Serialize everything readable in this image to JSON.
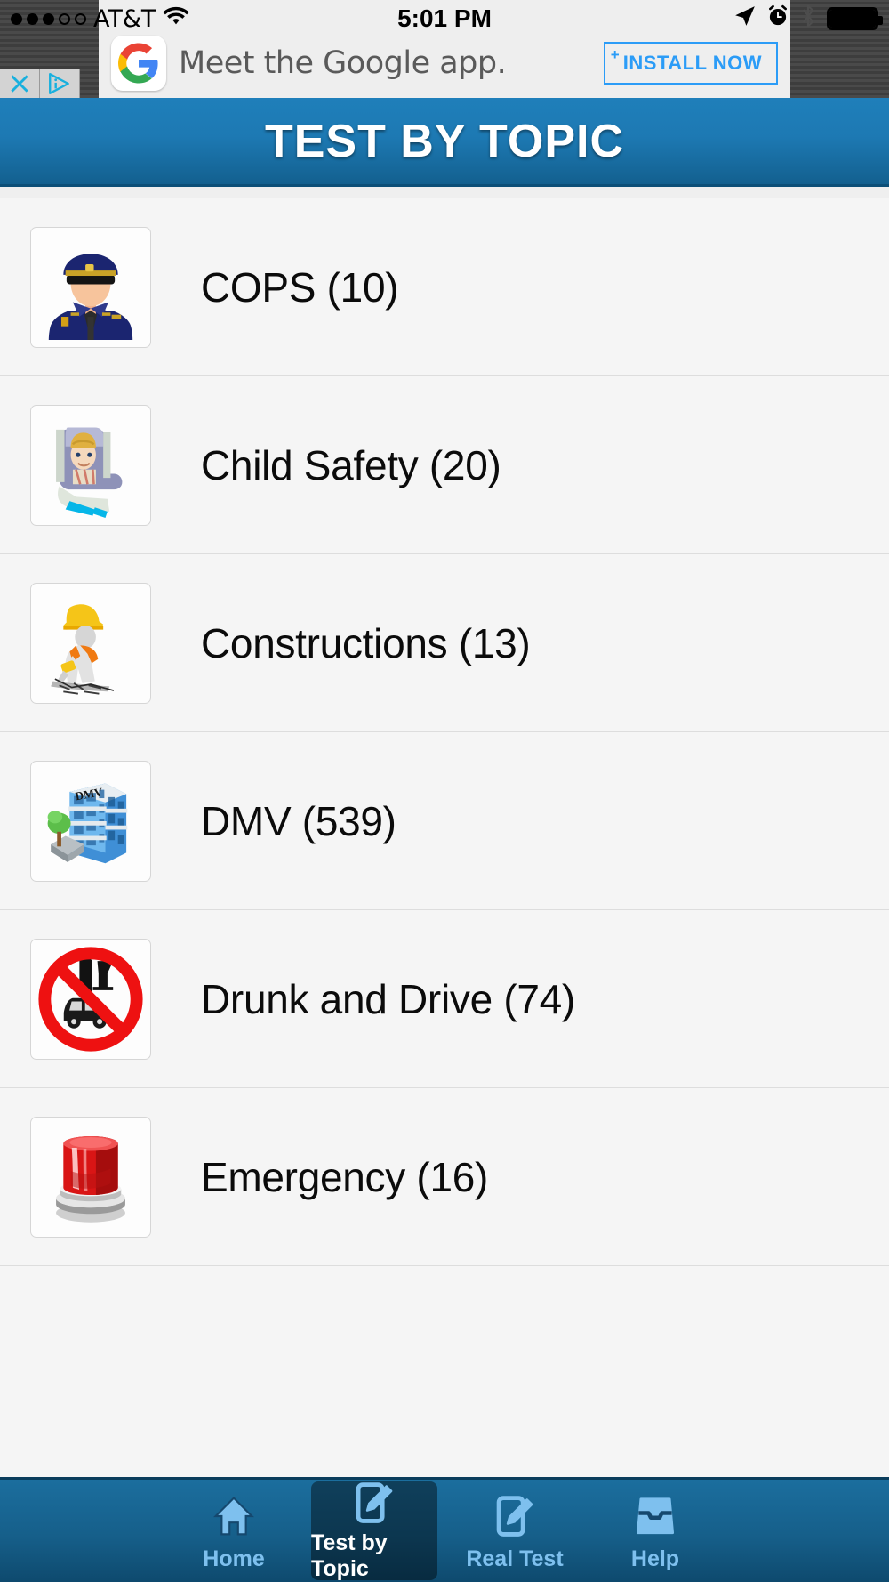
{
  "status_bar": {
    "carrier": "AT&T",
    "signal_dots_filled": 3,
    "signal_dots_total": 5,
    "wifi_icon": "wifi-icon",
    "time": "5:01 PM",
    "location_icon": "location-arrow-icon",
    "alarm_icon": "alarm-clock-icon",
    "bluetooth_icon": "bluetooth-icon",
    "battery_icon": "battery-full-icon"
  },
  "ad": {
    "logo": "google-g-logo",
    "text": "Meet the Google app.",
    "cta_label": "INSTALL NOW",
    "cta_plus": "+",
    "close_icon": "close-icon",
    "info_icon": "ad-info-icon"
  },
  "header": {
    "title": "TEST BY TOPIC",
    "background_color": "#1d79b3"
  },
  "list": {
    "rows": [
      {
        "label": "COPS (10)",
        "icon": "police-officer-icon",
        "count": 10
      },
      {
        "label": "Child Safety (20)",
        "icon": "child-car-seat-icon",
        "count": 20
      },
      {
        "label": "Constructions (13)",
        "icon": "construction-worker-icon",
        "count": 13
      },
      {
        "label": "DMV (539)",
        "icon": "dmv-building-icon",
        "count": 539
      },
      {
        "label": "Drunk and Drive (74)",
        "icon": "no-drinking-driving-icon",
        "count": 74
      },
      {
        "label": "Emergency (16)",
        "icon": "emergency-siren-icon",
        "count": 16
      }
    ]
  },
  "tab_bar": {
    "accent_color": "#7ec0ee",
    "selected_index": 1,
    "tabs": [
      {
        "label": "Home",
        "icon": "home-icon"
      },
      {
        "label": "Test by Topic",
        "icon": "compose-icon"
      },
      {
        "label": "Real Test",
        "icon": "compose-icon"
      },
      {
        "label": "Help",
        "icon": "inbox-tray-icon"
      }
    ]
  }
}
